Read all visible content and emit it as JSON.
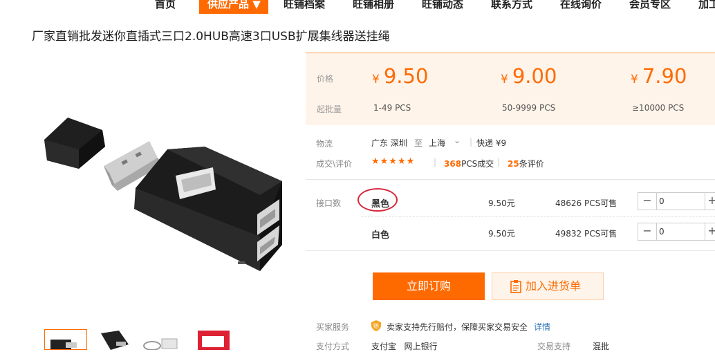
{
  "nav": {
    "items": [
      "首页",
      "供应产品 ▼",
      "旺铺档案",
      "旺铺相册",
      "旺铺动态",
      "联系方式",
      "在线询价",
      "会员专区",
      "加工"
    ]
  },
  "product": {
    "title": "厂家直销批发迷你直插式三口2.0HUB高速3口USB扩展集线器送挂绳"
  },
  "price": {
    "price_label": "价格",
    "moq_label": "起批量",
    "currency": "¥",
    "tiers": [
      {
        "value": "9.50",
        "range": "1-49",
        "unit": "PCS"
      },
      {
        "value": "9.00",
        "range": "50-9999",
        "unit": "PCS"
      },
      {
        "value": "7.90",
        "range": "≥10000",
        "unit": "PCS"
      }
    ]
  },
  "logistics": {
    "label": "物流",
    "from": "广东 深圳",
    "to_word": "至",
    "dest": "上海",
    "express": "快递 ¥9"
  },
  "deals": {
    "label": "成交\\评价",
    "stars": "★★★★★",
    "sold_count": "368",
    "sold_text": "PCS成交",
    "review_count": "25",
    "review_text": "条评价"
  },
  "variants": {
    "label": "接口数",
    "rows": [
      {
        "name": "黑色",
        "price": "9.50元",
        "stock": "48626 PCS可售",
        "qty": "0"
      },
      {
        "name": "白色",
        "price": "9.50元",
        "stock": "49832 PCS可售",
        "qty": "0"
      }
    ]
  },
  "stepper": {
    "minus": "−",
    "plus": "+"
  },
  "actions": {
    "order": "立即订购",
    "cart": "加入进货单"
  },
  "service": {
    "label": "买家服务",
    "text": "卖家支持先行赔付，保障买家交易安全",
    "detail": "详情"
  },
  "payment": {
    "label": "支付方式",
    "methods": "支付宝   网上银行",
    "trade_label": "交易支持",
    "trade_value": "混批"
  },
  "colors": {
    "accent": "#ff6a00",
    "highlight_circle": "#d7263d"
  }
}
